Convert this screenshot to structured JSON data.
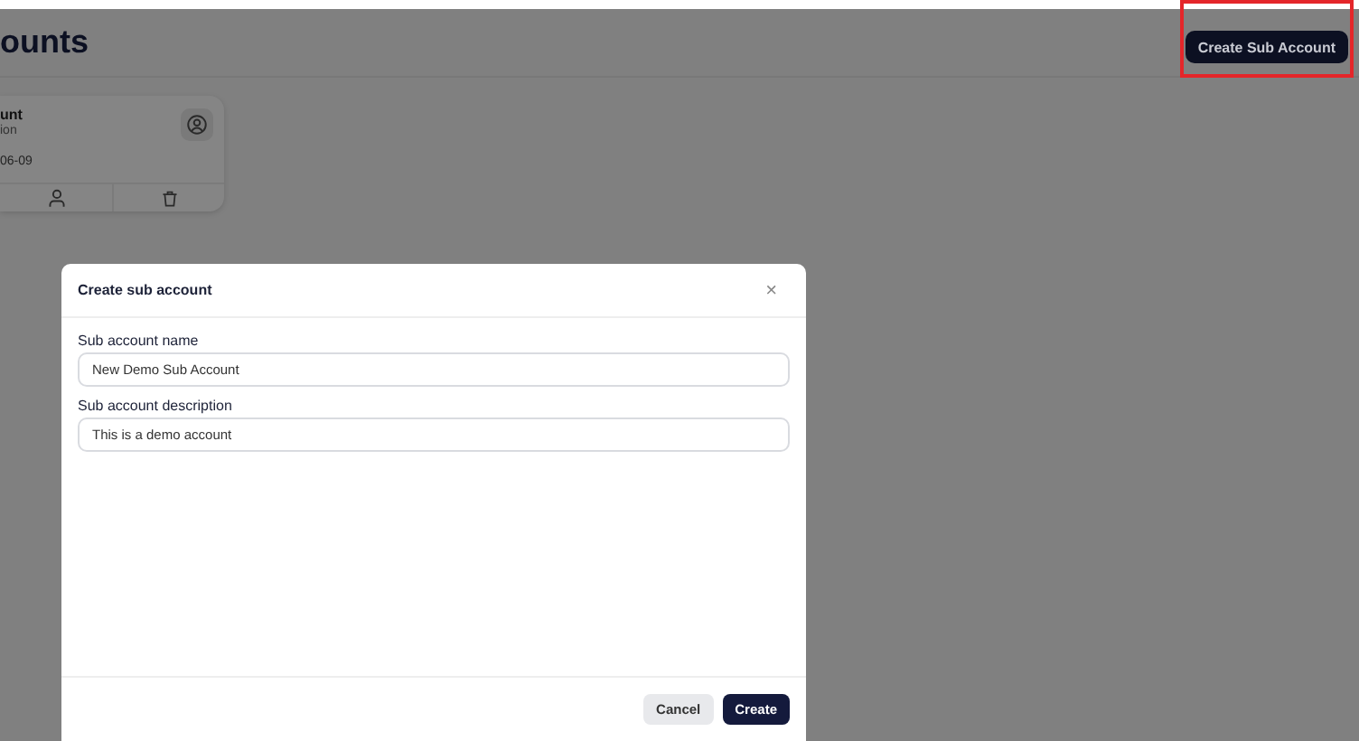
{
  "page": {
    "title": "ounts",
    "create_button": "Create Sub Account"
  },
  "cards": [
    {
      "name": "unt",
      "description": "ion",
      "date": "06-09"
    }
  ],
  "dialog": {
    "title": "Create sub account",
    "close": "×",
    "fields": [
      {
        "label": "Sub account name",
        "value": "New Demo Sub Account"
      },
      {
        "label": "Sub account description",
        "value": "This is a demo account"
      }
    ],
    "buttons": [
      {
        "label": "Cancel",
        "kind": "secondary"
      },
      {
        "label": "Create",
        "kind": "primary"
      }
    ]
  }
}
